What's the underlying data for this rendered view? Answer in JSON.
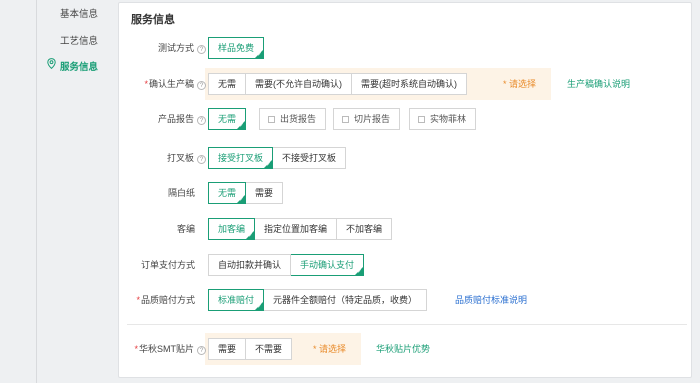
{
  "sidebar": {
    "items": [
      {
        "label": "基本信息",
        "active": false
      },
      {
        "label": "工艺信息",
        "active": false
      },
      {
        "label": "服务信息",
        "active": true
      }
    ]
  },
  "panel": {
    "title": "服务信息"
  },
  "fields": {
    "test_method": {
      "label": "测试方式",
      "options": [
        "样品免费"
      ],
      "selected": 0
    },
    "confirm_prod": {
      "label": "确认生产稿",
      "required": true,
      "options": [
        "无需",
        "需要(不允许自动确认)",
        "需要(超时系统自动确认)"
      ],
      "please": "请选择",
      "link": "生产稿确认说明"
    },
    "product_report": {
      "label": "产品报告",
      "options": [
        "无需"
      ],
      "selected": 0,
      "checkboxes": [
        "出货报告",
        "切片报告",
        "实物菲林"
      ]
    },
    "fork_board": {
      "label": "打叉板",
      "options": [
        "接受打叉板",
        "不接受打叉板"
      ],
      "selected": 0
    },
    "spacer_paper": {
      "label": "隔白纸",
      "options": [
        "无需",
        "需要"
      ],
      "selected": 0
    },
    "customer_code": {
      "label": "客编",
      "options": [
        "加客编",
        "指定位置加客编",
        "不加客编"
      ],
      "selected": 0
    },
    "payment": {
      "label": "订单支付方式",
      "options": [
        "自动扣款并确认",
        "手动确认支付"
      ],
      "selected": 1
    },
    "quality_comp": {
      "label": "品质赔付方式",
      "required": true,
      "options": [
        "标准赔付",
        "元器件全额赔付（特定品质，收费）"
      ],
      "selected": 0,
      "link": "品质赔付标准说明"
    },
    "smt_patch": {
      "label": "华秋SMT贴片",
      "required": true,
      "options": [
        "需要",
        "不需要"
      ],
      "please": "请选择",
      "link": "华秋贴片优势"
    }
  },
  "icons": {
    "help": "help-icon",
    "check": "check-icon",
    "pin": "location-pin-icon"
  },
  "colors": {
    "accent": "#1a9e76",
    "warning": "#e98b2a",
    "required": "#e4393c",
    "link_blue": "#2a6fd0",
    "highlight_bg": "#fdf3e6"
  }
}
